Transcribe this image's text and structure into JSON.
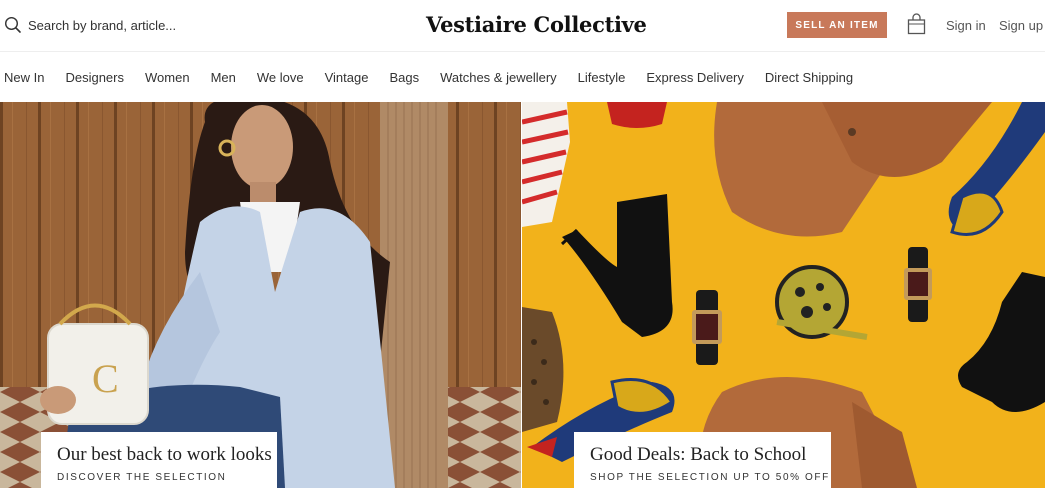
{
  "header": {
    "search_placeholder": "Search by brand, article...",
    "search_icon": "search-icon",
    "logo": "Vestiaire Collective",
    "sell_label": "SELL AN ITEM",
    "bag_icon": "shopping-bag-icon",
    "signin_label": "Sign in",
    "signup_label": "Sign up"
  },
  "nav": {
    "items": [
      {
        "label": "New In"
      },
      {
        "label": "Designers"
      },
      {
        "label": "Women"
      },
      {
        "label": "Men"
      },
      {
        "label": "We love"
      },
      {
        "label": "Vintage"
      },
      {
        "label": "Bags"
      },
      {
        "label": "Watches & jewellery"
      },
      {
        "label": "Lifestyle"
      },
      {
        "label": "Express Delivery"
      },
      {
        "label": "Direct Shipping"
      }
    ]
  },
  "hero": {
    "left": {
      "title": "Our best back to work looks",
      "subtitle": "DISCOVER THE SELECTION"
    },
    "right": {
      "title": "Good Deals: Back to School",
      "subtitle": "SHOP THE SELECTION UP TO 50% OFF"
    }
  },
  "colors": {
    "accent": "#c8795a",
    "hero_right_bg": "#f2b21b"
  }
}
